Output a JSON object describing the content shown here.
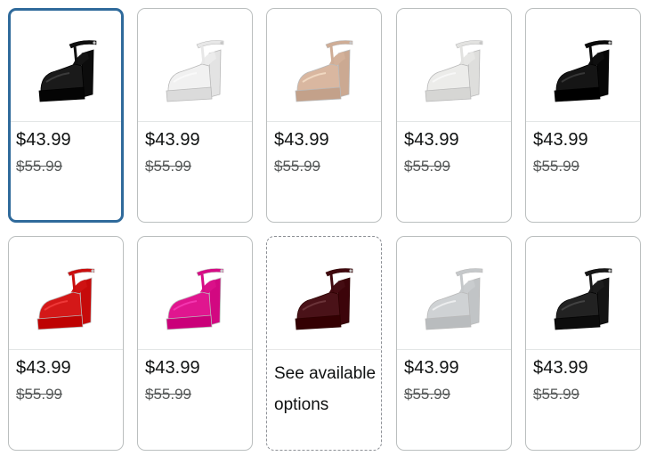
{
  "variants": [
    {
      "name": "black",
      "price": "$43.99",
      "list_price": "$55.99",
      "color": "#1a1a1a",
      "selected": true
    },
    {
      "name": "white",
      "price": "$43.99",
      "list_price": "$55.99",
      "color": "#f1f1f1"
    },
    {
      "name": "nude",
      "price": "$43.99",
      "list_price": "$55.99",
      "color": "#d9b7a0"
    },
    {
      "name": "white-satin",
      "price": "$43.99",
      "list_price": "$55.99",
      "color": "#ececea"
    },
    {
      "name": "black-patent",
      "price": "$43.99",
      "list_price": "$55.99",
      "color": "#151515"
    },
    {
      "name": "red",
      "price": "$43.99",
      "list_price": "$55.99",
      "color": "#d41818"
    },
    {
      "name": "hot-pink",
      "price": "$43.99",
      "list_price": "$55.99",
      "color": "#e0168f"
    },
    {
      "name": "burgundy",
      "see_options": "See available options",
      "color": "#4a1218",
      "unavailable": true
    },
    {
      "name": "silver",
      "price": "$43.99",
      "list_price": "$55.99",
      "color": "#cfd2d4"
    },
    {
      "name": "black-sequin",
      "price": "$43.99",
      "list_price": "$55.99",
      "color": "#222222"
    }
  ]
}
